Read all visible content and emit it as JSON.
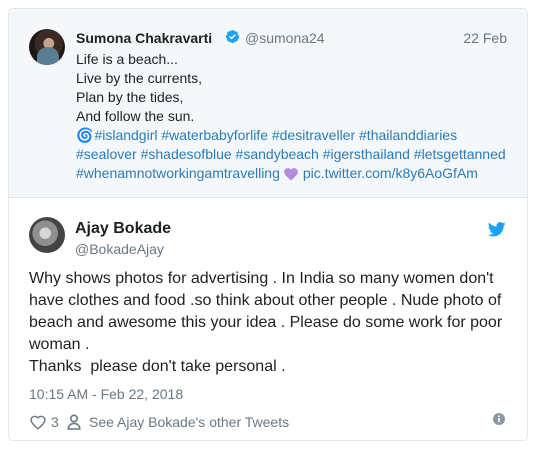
{
  "quoted_tweet": {
    "author_name": "Sumona Chakravarti",
    "author_handle": "@sumona24",
    "date": "22 Feb",
    "lines": [
      "Life is a beach...",
      "Live by the currents,",
      "Plan by the tides,",
      "And follow the sun."
    ],
    "hashtags_line1": "#islandgirl #waterbabyforlife #desitraveller #thailanddiaries",
    "hashtags_line2": "#sealover #shadesofblue #sandybeach #igersthailand #letsgettanned",
    "hashtags_line3": "#whenamnotworkingamtravelling",
    "pic_link": "pic.twitter.com/k8y6AoGfAm"
  },
  "reply_tweet": {
    "author_name": "Ajay Bokade",
    "author_handle": "@BokadeAjay",
    "lines": [
      "Why shows photos for advertising . In India so many women don't",
      "have clothes and food .so think about other people . Nude photo of",
      "beach and awesome this your idea . Please do some work for poor",
      "woman .",
      "Thanks  please don't take personal ."
    ],
    "timestamp": "10:15 AM - Feb 22, 2018",
    "like_count": "3",
    "other_tweets_link": "See Ajay Bokade's other Tweets"
  },
  "colors": {
    "link": "#2b7bb9",
    "muted": "#697882",
    "twitter_blue": "#1da1f2",
    "purple_heart": "#b48ce0"
  }
}
